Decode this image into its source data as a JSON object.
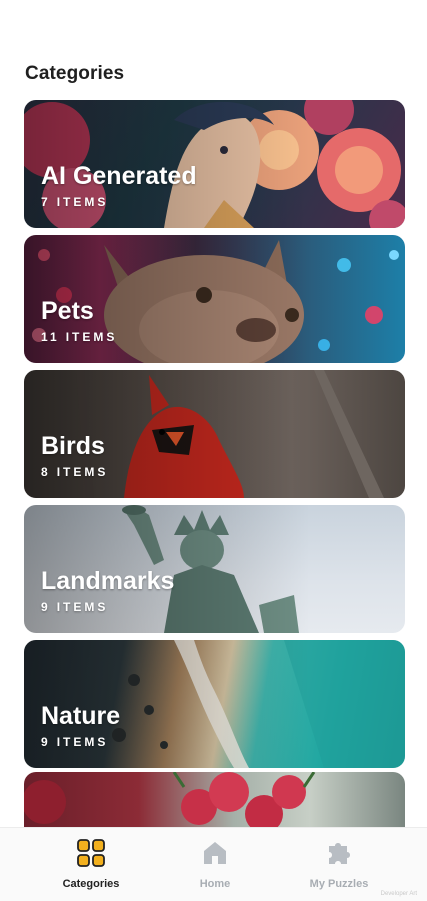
{
  "page": {
    "title": "Categories"
  },
  "categories": [
    {
      "name": "AI Generated",
      "count": "7",
      "unit": "ITEMS"
    },
    {
      "name": "Pets",
      "count": "11",
      "unit": "ITEMS"
    },
    {
      "name": "Birds",
      "count": "8",
      "unit": "ITEMS"
    },
    {
      "name": "Landmarks",
      "count": "9",
      "unit": "ITEMS"
    },
    {
      "name": "Nature",
      "count": "9",
      "unit": "ITEMS"
    }
  ],
  "bottom_nav": {
    "items": [
      {
        "label": "Categories",
        "icon": "grid-icon",
        "active": true
      },
      {
        "label": "Home",
        "icon": "home-icon",
        "active": false
      },
      {
        "label": "My Puzzles",
        "icon": "puzzle-icon",
        "active": false
      }
    ]
  },
  "colors": {
    "accent": "#f2b01e",
    "inactive": "#a8adb3",
    "text": "#202020"
  },
  "watermark": "Developer Art"
}
